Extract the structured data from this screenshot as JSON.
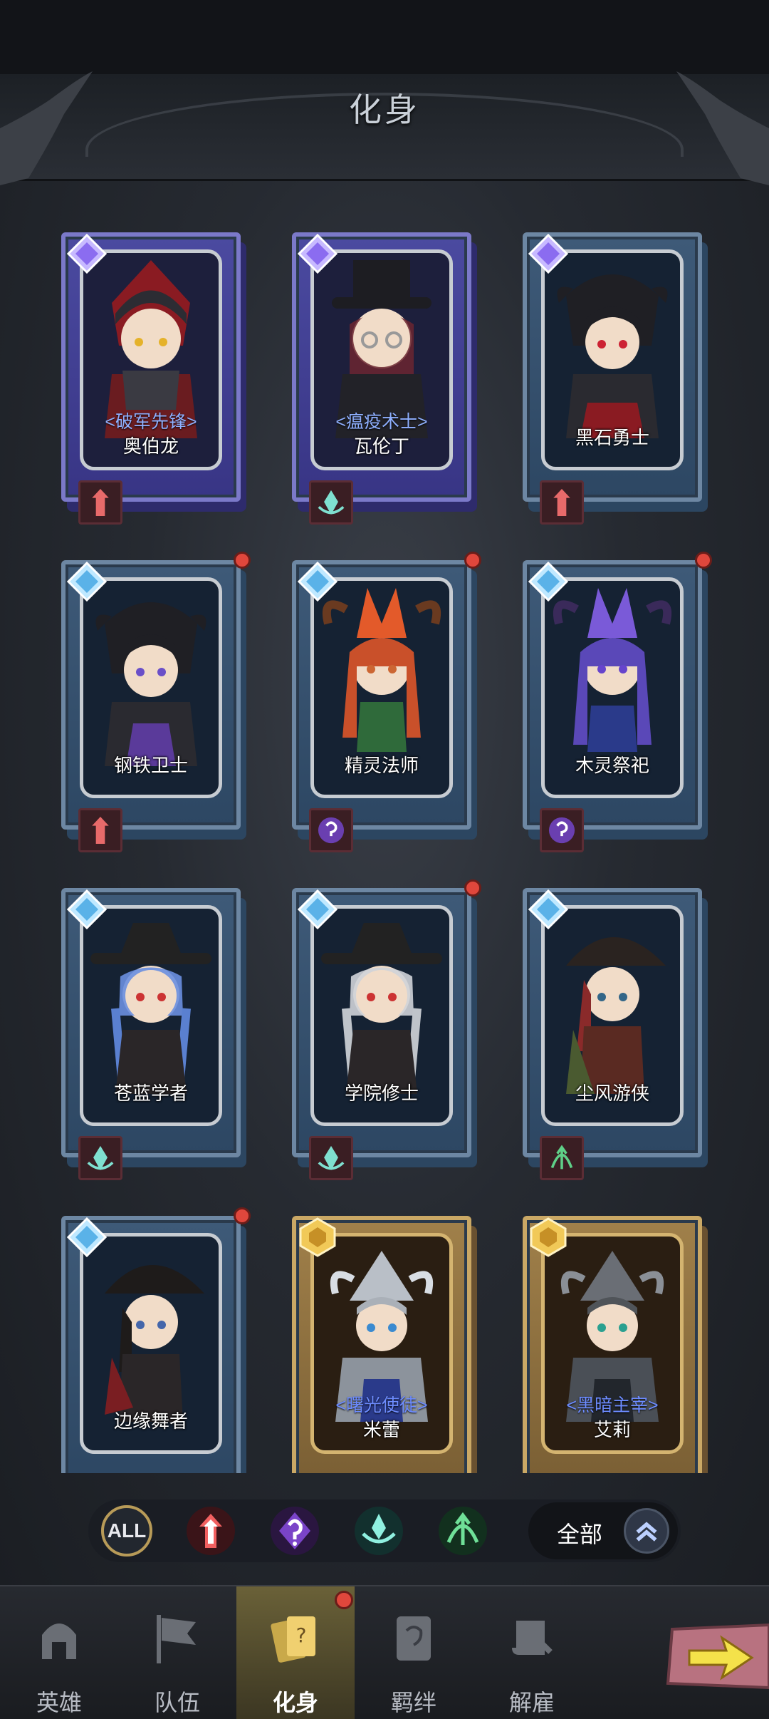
{
  "page": {
    "title": "化身"
  },
  "cards": [
    {
      "name": "奥伯龙",
      "title": "<破军先锋>",
      "frame": "purple",
      "role_icon": "warrior-icon",
      "new": false
    },
    {
      "name": "瓦伦丁",
      "title": "<瘟疫术士>",
      "frame": "purple",
      "role_icon": "support-icon",
      "new": false
    },
    {
      "name": "黑石勇士",
      "title": "",
      "frame": "blue",
      "role_icon": "warrior-icon",
      "new": false
    },
    {
      "name": "钢铁卫士",
      "title": "",
      "frame": "blue",
      "role_icon": "warrior-icon",
      "new": true
    },
    {
      "name": "精灵法师",
      "title": "",
      "frame": "blue",
      "role_icon": "mage-icon",
      "new": true
    },
    {
      "name": "木灵祭祀",
      "title": "",
      "frame": "blue",
      "role_icon": "mage-icon",
      "new": true
    },
    {
      "name": "苍蓝学者",
      "title": "",
      "frame": "blue",
      "role_icon": "support-icon",
      "new": false
    },
    {
      "name": "学院修士",
      "title": "",
      "frame": "blue",
      "role_icon": "support-icon",
      "new": true
    },
    {
      "name": "尘风游侠",
      "title": "",
      "frame": "blue",
      "role_icon": "ranger-icon",
      "new": false
    },
    {
      "name": "边缘舞者",
      "title": "",
      "frame": "blue",
      "role_icon": "warrior-icon",
      "new": true
    },
    {
      "name": "米蕾",
      "title": "<曙光使徒>",
      "frame": "gold",
      "role_icon": "",
      "new": false
    },
    {
      "name": "艾莉",
      "title": "<黑暗主宰>",
      "frame": "gold",
      "role_icon": "",
      "new": false
    }
  ],
  "filter": {
    "all_label": "ALL",
    "sort_label": "全部",
    "icons": [
      "warrior-icon",
      "mage-icon",
      "support-icon",
      "ranger-icon"
    ]
  },
  "nav": {
    "tabs": [
      {
        "label": "英雄",
        "icon": "helmet-icon"
      },
      {
        "label": "队伍",
        "icon": "banner-icon"
      },
      {
        "label": "化身",
        "icon": "cards-icon"
      },
      {
        "label": "羁绊",
        "icon": "tome-icon"
      },
      {
        "label": "解雇",
        "icon": "scroll-icon"
      }
    ],
    "active_tab": "化身"
  },
  "colors": {
    "accent_gold": "#b89b58",
    "notify_red": "#e0473c",
    "title_blue": "#8fb0ff"
  }
}
